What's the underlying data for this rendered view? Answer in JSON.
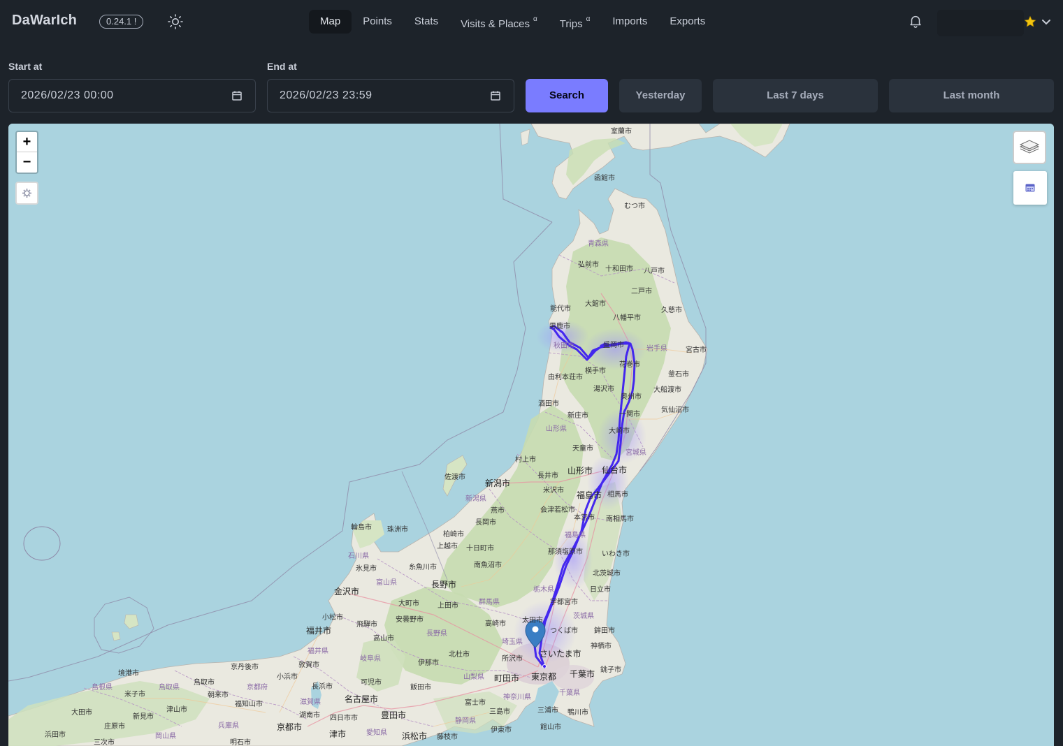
{
  "app": {
    "brand": "DaWarIch",
    "version": "0.24.1 !"
  },
  "nav": {
    "items": [
      {
        "label": "Map",
        "active": true,
        "sup": ""
      },
      {
        "label": "Points",
        "active": false,
        "sup": ""
      },
      {
        "label": "Stats",
        "active": false,
        "sup": ""
      },
      {
        "label": "Visits & Places",
        "active": false,
        "sup": "α"
      },
      {
        "label": "Trips",
        "active": false,
        "sup": "α"
      },
      {
        "label": "Imports",
        "active": false,
        "sup": ""
      },
      {
        "label": "Exports",
        "active": false,
        "sup": ""
      }
    ]
  },
  "form": {
    "start_label": "Start at",
    "start_value": "2026/02/23 00:00",
    "end_label": "End at",
    "end_value": "2026/02/23 23:59",
    "search_label": "Search",
    "yesterday_label": "Yesterday",
    "last7_label": "Last 7 days",
    "lastmonth_label": "Last month"
  },
  "map": {
    "zoom_in": "+",
    "zoom_out": "−",
    "route_color": "#3d1ff0",
    "cities": {
      "muroran": "室蘭市",
      "hakodate": "函館市",
      "mutsu": "むつ市",
      "aomori_pref": "青森県",
      "hirosaki": "弘前市",
      "towada": "十和田市",
      "hachinohe": "八戸市",
      "ninohe": "二戸市",
      "odate": "大館市",
      "noshiro": "能代市",
      "kuji": "久慈市",
      "hachimantai": "八幡平市",
      "oga": "男鹿市",
      "akita": "秋田市",
      "morioka": "盛岡市",
      "iwate_pref": "岩手県",
      "miyako": "宮古市",
      "hanamaki": "花巻市",
      "yokote": "横手市",
      "yurihonjo": "由利本荘市",
      "kamaishi": "釜石市",
      "yuzawa": "湯沢市",
      "ofunato": "大船渡市",
      "oshu": "奥州市",
      "sakata": "酒田市",
      "kesennuma": "気仙沼市",
      "shinjo": "新庄市",
      "ichinoseki": "一関市",
      "yamagata_pref": "山形県",
      "osaki": "大崎市",
      "tendo": "天童市",
      "miyagi_pref": "宮城県",
      "murakami": "村上市",
      "yamagata": "山形市",
      "sendai": "仙台市",
      "sado": "佐渡市",
      "niigata": "新潟市",
      "nagai": "長井市",
      "yonezawa": "米沢市",
      "fukushima": "福島市",
      "soma": "相馬市",
      "niigata_pref": "新潟県",
      "tsubame": "燕市",
      "aizu": "会津若松市",
      "nagaoka": "長岡市",
      "motomiya": "本宮市",
      "minamisoma": "南相馬市",
      "wajima": "輪島市",
      "suzu": "珠洲市",
      "kashiwazaki": "柏崎市",
      "fukushima_pref": "福島県",
      "joetsu": "上越市",
      "tokamachi": "十日町市",
      "ishikawa_pref": "石川県",
      "nasushiobara": "那須塩原市",
      "iwaki": "いわき市",
      "himi": "氷見市",
      "itoigawa": "糸魚川市",
      "minamiuonuma": "南魚沼市",
      "toyama_pref": "富山県",
      "kitaibaraki": "北茨城市",
      "nagano": "長野市",
      "kanazawa": "金沢市",
      "tochigi_pref": "栃木県",
      "hitachi": "日立市",
      "omachi": "大町市",
      "ueda": "上田市",
      "gunma_pref": "群馬県",
      "utsunomiya": "宇都宮市",
      "komatsu": "小松市",
      "ibaraki_pref": "茨城県",
      "hida": "飛騨市",
      "azumino": "安曇野市",
      "takasaki": "高崎市",
      "ota": "太田市",
      "fukui": "福井市",
      "takayama": "高山市",
      "nagano_pref": "長野県",
      "tsukuba": "つくば市",
      "hokota": "鉾田市",
      "saitama_pref": "埼玉県",
      "kamisu": "神栖市",
      "fukui_pref": "福井県",
      "gifu_pref": "岐阜県",
      "ina": "伊那市",
      "hokuto": "北杜市",
      "tokorozawa": "所沢市",
      "saitama": "さいたま市",
      "kyotango": "京丹後市",
      "tsuruga": "敦賀市",
      "choshi": "銚子市",
      "yamanashi_pref": "山梨県",
      "machida": "町田市",
      "tokyo": "東京都",
      "chiba": "千葉市",
      "sakaiminato": "境港市",
      "tottori": "鳥取市",
      "obama": "小浜市",
      "nagahama": "長浜市",
      "kani": "可児市",
      "iida": "飯田市",
      "shimane_pref": "島根県",
      "tottori_pref": "鳥取県",
      "kyoto_pref": "京都府",
      "yonago": "米子市",
      "asago": "朝来市",
      "kanagawa_pref": "神奈川県",
      "chiba_pref": "千葉県",
      "fukuchiyama": "福知山市",
      "shiga_pref": "滋賀県",
      "nagoya": "名古屋市",
      "fuji": "富士市",
      "oda": "大田市",
      "tsuyama": "津山市",
      "mishima": "三島市",
      "miura": "三浦市",
      "kamogawa": "鴨川市",
      "niimi": "新見市",
      "konan": "湖南市",
      "yokkaichi": "四日市市",
      "toyota": "豊田市",
      "shobara": "庄原市",
      "hyogo_pref": "兵庫県",
      "shizuoka_pref": "静岡県",
      "hamada": "浜田市",
      "kyoto": "京都市",
      "ito": "伊東市",
      "tateyama": "館山市",
      "okayama_pref": "岡山県",
      "aichi_pref": "愛知県",
      "tsu": "津市",
      "hamamatsu": "浜松市",
      "fujieda": "藤枝市",
      "miyoshi": "三次市",
      "akashi": "明石市"
    }
  }
}
